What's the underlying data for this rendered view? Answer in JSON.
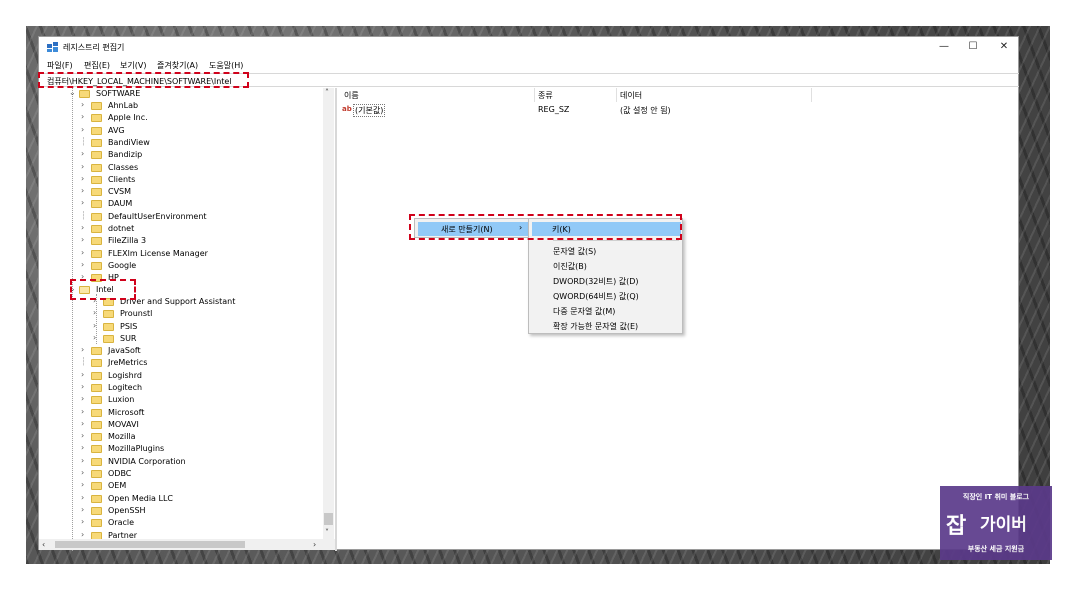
{
  "window": {
    "title": "레지스트리 편집기",
    "minimize": "—",
    "maximize": "☐",
    "close": "✕"
  },
  "menu": [
    "파일(F)",
    "편집(E)",
    "보기(V)",
    "즐겨찾기(A)",
    "도움말(H)"
  ],
  "address": "컴퓨터\\HKEY_LOCAL_MACHINE\\SOFTWARE\\Intel",
  "tree": {
    "root": "SOFTWARE",
    "items_before": [
      "AhnLab",
      "Apple Inc.",
      "AVG",
      "BandiView",
      "Bandizip",
      "Classes",
      "Clients",
      "CVSM",
      "DAUM",
      "DefaultUserEnvironment",
      "dotnet",
      "FileZilla 3",
      "FLEXlm License Manager",
      "Google",
      "HP"
    ],
    "expanded": "Intel",
    "children": [
      "Driver and Support Assistant",
      "Prounstl",
      "PSIS",
      "SUR"
    ],
    "items_after": [
      "JavaSoft",
      "JreMetrics",
      "Logishrd",
      "Logitech",
      "Luxion",
      "Microsoft",
      "MOVAVI",
      "Mozilla",
      "MozillaPlugins",
      "NVIDIA Corporation",
      "ODBC",
      "OEM",
      "Open Media LLC",
      "OpenSSH",
      "Oracle",
      "Partner"
    ]
  },
  "list": {
    "columns": [
      "이름",
      "종류",
      "데이터"
    ],
    "rows": [
      {
        "name": "(기본값)",
        "type": "REG_SZ",
        "data": "(값 설정 안 됨)"
      }
    ]
  },
  "context_menu": {
    "new": "새로 만들기(N)",
    "arrow": "›",
    "submenu": [
      "키(K)",
      "문자열 값(S)",
      "이진값(B)",
      "DWORD(32비트) 값(D)",
      "QWORD(64비트) 값(Q)",
      "다중 문자열 값(M)",
      "확장 가능한 문자열 값(E)"
    ]
  },
  "watermark": {
    "top": "직장인 IT 취미 블로그",
    "mid1": "잡",
    "mid2": "가이버",
    "bottom": "부동산 세금 지원금"
  }
}
